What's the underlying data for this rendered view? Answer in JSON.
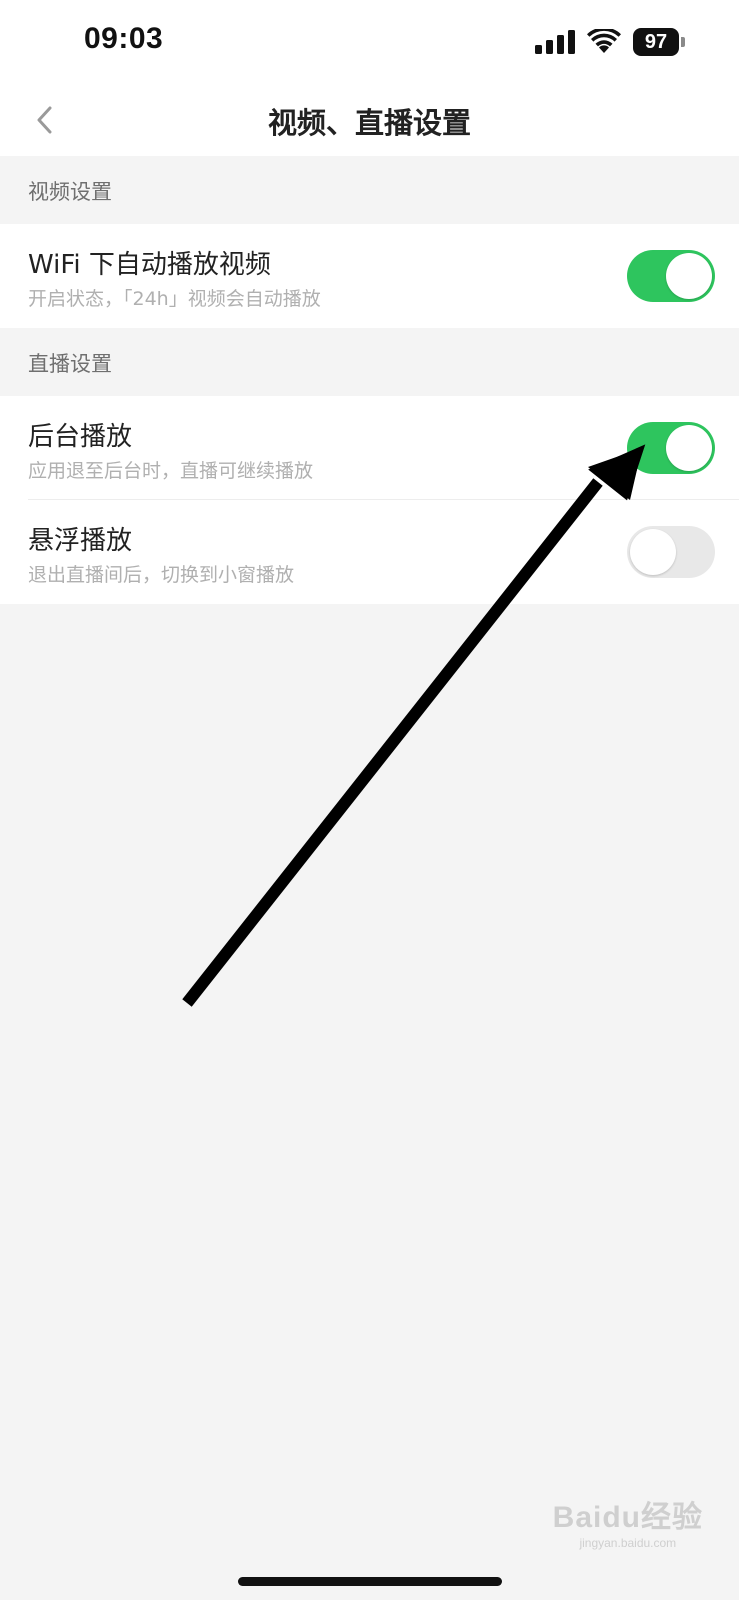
{
  "status_bar": {
    "time": "09:03",
    "battery": "97",
    "icons": [
      "signal-icon",
      "wifi-icon",
      "battery-icon"
    ]
  },
  "nav": {
    "back_icon": "chevron-left-icon",
    "title": "视频、直播设置"
  },
  "sections": [
    {
      "header": "视频设置",
      "items": [
        {
          "title": "WiFi 下自动播放视频",
          "subtitle": "开启状态，「24h」视频会自动播放",
          "enabled": true
        }
      ]
    },
    {
      "header": "直播设置",
      "items": [
        {
          "title": "后台播放",
          "subtitle": "应用退至后台时，直播可继续播放",
          "enabled": true
        },
        {
          "title": "悬浮播放",
          "subtitle": "退出直播间后，切换到小窗播放",
          "enabled": false
        }
      ]
    }
  ],
  "colors": {
    "toggle_on": "#2ec55e",
    "toggle_off": "#e8e8e8",
    "background": "#f4f4f4",
    "annotation_arrow": "#000000"
  },
  "watermark": {
    "logo": "Baidu经验",
    "url": "jingyan.baidu.com"
  }
}
